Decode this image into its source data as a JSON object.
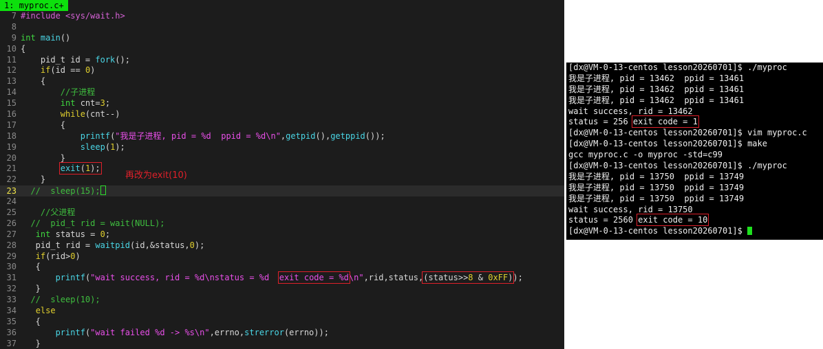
{
  "editor": {
    "tab_label": "1: myproc.c+",
    "annotation": "再改为exit(10)",
    "lines": [
      {
        "n": "7",
        "tokens": [
          [
            "pp",
            "#include "
          ],
          [
            "pp",
            "<sys/wait.h>"
          ]
        ]
      },
      {
        "n": "8",
        "tokens": []
      },
      {
        "n": "9",
        "tokens": [
          [
            "ty",
            "int"
          ],
          [
            "id",
            " "
          ],
          [
            "fn",
            "main"
          ],
          [
            "id",
            "()"
          ]
        ]
      },
      {
        "n": "10",
        "tokens": [
          [
            "id",
            "{"
          ]
        ]
      },
      {
        "n": "11",
        "tokens": [
          [
            "id",
            "    pid_t id = "
          ],
          [
            "fn",
            "fork"
          ],
          [
            "id",
            "();"
          ]
        ]
      },
      {
        "n": "12",
        "tokens": [
          [
            "id",
            "    "
          ],
          [
            "kw",
            "if"
          ],
          [
            "id",
            "(id == "
          ],
          [
            "num",
            "0"
          ],
          [
            "id",
            ")"
          ]
        ]
      },
      {
        "n": "13",
        "tokens": [
          [
            "id",
            "    {"
          ]
        ]
      },
      {
        "n": "14",
        "tokens": [
          [
            "id",
            "        "
          ],
          [
            "cm",
            "//子进程"
          ]
        ]
      },
      {
        "n": "15",
        "tokens": [
          [
            "id",
            "        "
          ],
          [
            "ty",
            "int"
          ],
          [
            "id",
            " cnt="
          ],
          [
            "num",
            "3"
          ],
          [
            "id",
            ";"
          ]
        ]
      },
      {
        "n": "16",
        "tokens": [
          [
            "id",
            "        "
          ],
          [
            "kw",
            "while"
          ],
          [
            "id",
            "(cnt--)"
          ]
        ]
      },
      {
        "n": "17",
        "tokens": [
          [
            "id",
            "        {"
          ]
        ]
      },
      {
        "n": "18",
        "tokens": [
          [
            "id",
            "            "
          ],
          [
            "fn",
            "printf"
          ],
          [
            "id",
            "("
          ],
          [
            "str",
            "\"我是子进程, pid = %d  ppid = %d\\n\""
          ],
          [
            "id",
            ","
          ],
          [
            "fn",
            "getpid"
          ],
          [
            "id",
            "(),"
          ],
          [
            "fn",
            "getppid"
          ],
          [
            "id",
            "());"
          ]
        ]
      },
      {
        "n": "19",
        "tokens": [
          [
            "id",
            "            "
          ],
          [
            "fn",
            "sleep"
          ],
          [
            "id",
            "("
          ],
          [
            "num",
            "1"
          ],
          [
            "id",
            ");"
          ]
        ]
      },
      {
        "n": "20",
        "tokens": [
          [
            "id",
            "        }"
          ]
        ]
      },
      {
        "n": "21",
        "tokens": [
          [
            "id",
            "        "
          ],
          [
            "fn",
            "exit",
            "box"
          ],
          [
            "id",
            "(",
            "box"
          ],
          [
            "num",
            "1",
            "box"
          ],
          [
            "id",
            ");",
            "box"
          ]
        ]
      },
      {
        "n": "22",
        "tokens": [
          [
            "id",
            "    }"
          ]
        ]
      },
      {
        "n": "23",
        "cur": true,
        "tokens": [
          [
            "id",
            "  "
          ],
          [
            "cm",
            "//  sleep(15);"
          ],
          [
            "cursor",
            ""
          ]
        ]
      },
      {
        "n": "24",
        "tokens": []
      },
      {
        "n": "25",
        "tokens": [
          [
            "id",
            "    "
          ],
          [
            "cm",
            "//父进程"
          ]
        ]
      },
      {
        "n": "26",
        "tokens": [
          [
            "id",
            "  "
          ],
          [
            "cm",
            "//  pid_t rid = wait(NULL);"
          ]
        ]
      },
      {
        "n": "27",
        "tokens": [
          [
            "id",
            "   "
          ],
          [
            "ty",
            "int"
          ],
          [
            "id",
            " status = "
          ],
          [
            "num",
            "0"
          ],
          [
            "id",
            ";"
          ]
        ]
      },
      {
        "n": "28",
        "tokens": [
          [
            "id",
            "   pid_t rid = "
          ],
          [
            "fn",
            "waitpid"
          ],
          [
            "id",
            "(id,&status,"
          ],
          [
            "num",
            "0"
          ],
          [
            "id",
            ");"
          ]
        ]
      },
      {
        "n": "29",
        "tokens": [
          [
            "id",
            "   "
          ],
          [
            "kw",
            "if"
          ],
          [
            "id",
            "(rid>"
          ],
          [
            "num",
            "0"
          ],
          [
            "id",
            ")"
          ]
        ]
      },
      {
        "n": "30",
        "tokens": [
          [
            "id",
            "   {"
          ]
        ]
      },
      {
        "n": "31",
        "tokens": [
          [
            "id",
            "       "
          ],
          [
            "fn",
            "printf"
          ],
          [
            "id",
            "("
          ],
          [
            "str",
            "\"wait success, rid = %d\\nstatus = %d  "
          ],
          [
            "str",
            "exit code = %d",
            "box"
          ],
          [
            "str",
            "\\n\""
          ],
          [
            "id",
            ",rid,status,"
          ],
          [
            "id",
            "(status>>",
            "box2"
          ],
          [
            "num",
            "8",
            "box2"
          ],
          [
            "id",
            " & ",
            "box2"
          ],
          [
            "num",
            "0xFF",
            "box2"
          ],
          [
            "id",
            ")",
            "box2"
          ],
          [
            "id",
            ");"
          ]
        ]
      },
      {
        "n": "32",
        "tokens": [
          [
            "id",
            "   }"
          ]
        ]
      },
      {
        "n": "33",
        "tokens": [
          [
            "id",
            "  "
          ],
          [
            "cm",
            "//  sleep(10);"
          ]
        ]
      },
      {
        "n": "34",
        "tokens": [
          [
            "id",
            "   "
          ],
          [
            "kw",
            "else"
          ]
        ]
      },
      {
        "n": "35",
        "tokens": [
          [
            "id",
            "   {"
          ]
        ]
      },
      {
        "n": "36",
        "tokens": [
          [
            "id",
            "       "
          ],
          [
            "fn",
            "printf"
          ],
          [
            "id",
            "("
          ],
          [
            "str",
            "\"wait failed %d -> %s\\n\""
          ],
          [
            "id",
            ",errno,"
          ],
          [
            "fn",
            "strerror"
          ],
          [
            "id",
            "(errno));"
          ]
        ]
      },
      {
        "n": "37",
        "tokens": [
          [
            "id",
            "   }"
          ]
        ]
      }
    ]
  },
  "terminal": {
    "lines": [
      {
        "text": "[dx@VM-0-13-centos lesson20260701]$ ./myproc"
      },
      {
        "text": "我是子进程, pid = 13462  ppid = 13461"
      },
      {
        "text": "我是子进程, pid = 13462  ppid = 13461"
      },
      {
        "text": "我是子进程, pid = 13462  ppid = 13461"
      },
      {
        "text": "wait success, rid = 13462"
      },
      {
        "text": "status = 256 ",
        "boxed": "exit code = 1"
      },
      {
        "text": "[dx@VM-0-13-centos lesson20260701]$ vim myproc.c"
      },
      {
        "text": "[dx@VM-0-13-centos lesson20260701]$ make"
      },
      {
        "text": "gcc myproc.c -o myproc -std=c99"
      },
      {
        "text": "[dx@VM-0-13-centos lesson20260701]$ ./myproc"
      },
      {
        "text": "我是子进程, pid = 13750  ppid = 13749"
      },
      {
        "text": "我是子进程, pid = 13750  ppid = 13749"
      },
      {
        "text": "我是子进程, pid = 13750  ppid = 13749"
      },
      {
        "text": "wait success, rid = 13750"
      },
      {
        "text": "status = 2560 ",
        "boxed": "exit code = 10"
      },
      {
        "text": "[dx@VM-0-13-centos lesson20260701]$ ",
        "cursor": true
      }
    ]
  }
}
